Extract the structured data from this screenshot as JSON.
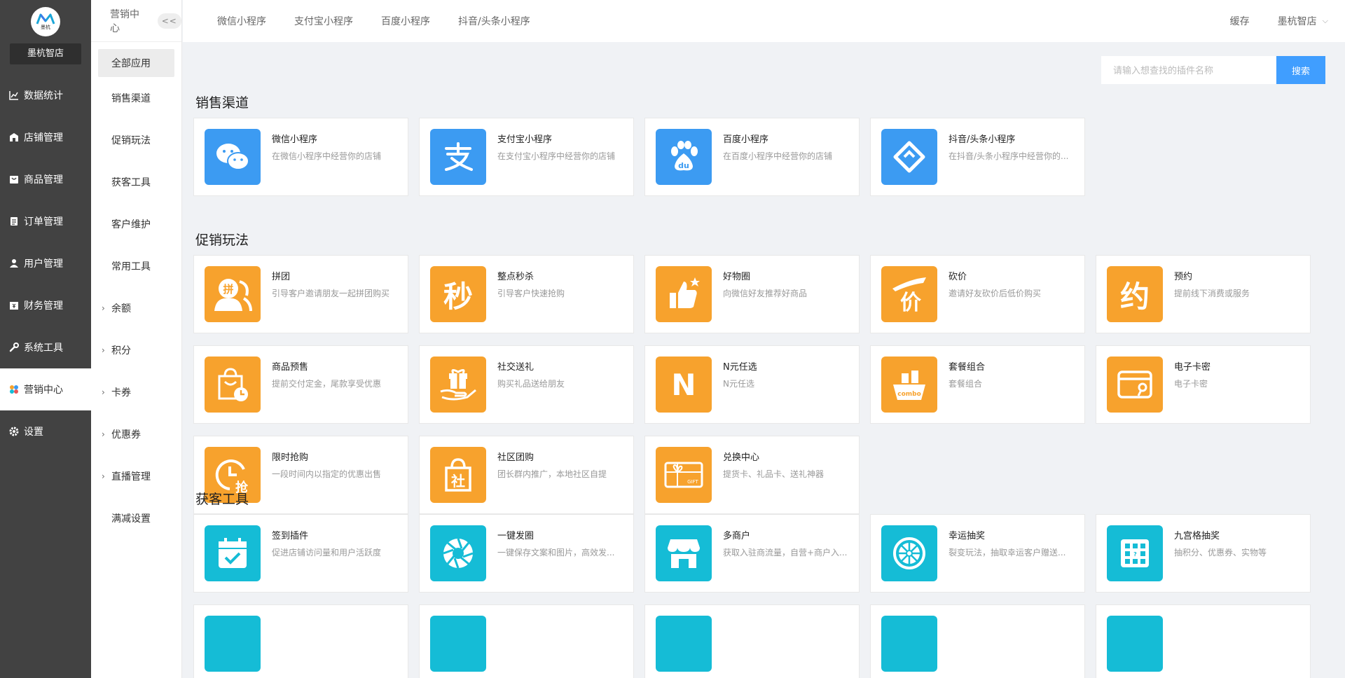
{
  "sidebar": {
    "logo_text": "墨杭",
    "shop_name": "墨杭智店",
    "items": [
      {
        "label": "数据统计",
        "icon": "chart-icon"
      },
      {
        "label": "店铺管理",
        "icon": "shop-icon"
      },
      {
        "label": "商品管理",
        "icon": "goods-icon"
      },
      {
        "label": "订单管理",
        "icon": "order-icon"
      },
      {
        "label": "用户管理",
        "icon": "user-icon"
      },
      {
        "label": "财务管理",
        "icon": "finance-icon"
      },
      {
        "label": "系统工具",
        "icon": "wrench-icon"
      },
      {
        "label": "营销中心",
        "icon": "marketing-icon"
      },
      {
        "label": "设置",
        "icon": "gear-icon"
      }
    ]
  },
  "subnav": {
    "title": "营销中心",
    "collapse_label": "<<",
    "items": [
      "全部应用",
      "销售渠道",
      "促销玩法",
      "获客工具",
      "客户维护",
      "常用工具"
    ],
    "expandable": [
      "余额",
      "积分",
      "卡券",
      "优惠券",
      "直播管理"
    ],
    "last": "满减设置"
  },
  "topbar": {
    "tabs": [
      "微信小程序",
      "支付宝小程序",
      "百度小程序",
      "抖音/头条小程序"
    ],
    "cache": "缓存",
    "user": "墨杭智店"
  },
  "search": {
    "placeholder": "请输入想查找的插件名称",
    "button": "搜索"
  },
  "sections": {
    "channels": {
      "title": "销售渠道",
      "cards": [
        {
          "name": "微信小程序",
          "desc": "在微信小程序中经营你的店铺",
          "icon": "wechat-icon"
        },
        {
          "name": "支付宝小程序",
          "desc": "在支付宝小程序中经营你的店铺",
          "icon": "alipay-icon"
        },
        {
          "name": "百度小程序",
          "desc": "在百度小程序中经营你的店铺",
          "icon": "baidu-icon"
        },
        {
          "name": "抖音/头条小程序",
          "desc": "在抖音/头条小程序中经营你的...",
          "icon": "douyin-icon"
        }
      ]
    },
    "promo": {
      "title": "促销玩法",
      "cards": [
        {
          "name": "拼团",
          "desc": "引导客户邀请朋友一起拼团购买",
          "icon": "group-buy-icon",
          "glyph": "拼"
        },
        {
          "name": "整点秒杀",
          "desc": "引导客户快速抢购",
          "icon": "flash-sale-icon",
          "glyph": "秒"
        },
        {
          "name": "好物圈",
          "desc": "向微信好友推荐好商品",
          "icon": "thumbs-up-icon"
        },
        {
          "name": "砍价",
          "desc": "邀请好友砍价后低价购买",
          "icon": "bargain-icon",
          "glyph": "价"
        },
        {
          "name": "预约",
          "desc": "提前线下消费或服务",
          "icon": "reservation-icon",
          "glyph": "约"
        },
        {
          "name": "商品预售",
          "desc": "提前交付定金，尾款享受优惠",
          "icon": "presale-bag-icon"
        },
        {
          "name": "社交送礼",
          "desc": "购买礼品送给朋友",
          "icon": "gift-hand-icon"
        },
        {
          "name": "N元任选",
          "desc": "N元任选",
          "icon": "n-choice-icon",
          "glyph": "N"
        },
        {
          "name": "套餐组合",
          "desc": "套餐组合",
          "icon": "combo-icon"
        },
        {
          "name": "电子卡密",
          "desc": "电子卡密",
          "icon": "ecard-icon"
        },
        {
          "name": "限时抢购",
          "desc": "一段时间内以指定的优惠出售",
          "icon": "clock-rush-icon"
        },
        {
          "name": "社区团购",
          "desc": "团长群内推广，本地社区自提",
          "icon": "community-bag-icon"
        },
        {
          "name": "兑换中心",
          "desc": "提货卡、礼品卡、送礼神器",
          "icon": "gift-card-icon"
        }
      ]
    },
    "acquire": {
      "title": "获客工具",
      "cards": [
        {
          "name": "签到插件",
          "desc": "促进店铺访问量和用户活跃度",
          "icon": "calendar-check-icon"
        },
        {
          "name": "一键发圈",
          "desc": "一键保存文案和图片，高效发...",
          "icon": "aperture-icon"
        },
        {
          "name": "多商户",
          "desc": "获取入驻商流量，自营+商户入...",
          "icon": "store-icon"
        },
        {
          "name": "幸运抽奖",
          "desc": "裂变玩法，抽取幸运客户赠送...",
          "icon": "wheel-icon"
        },
        {
          "name": "九宫格抽奖",
          "desc": "抽积分、优惠券、实物等",
          "icon": "grid-lottery-icon"
        }
      ]
    }
  },
  "colors": {
    "sidebar_bg": "#424242",
    "accent_blue": "#409eff",
    "channel_blue": "#3c9bf2",
    "promo_orange": "#f7a22d",
    "acquire_teal": "#15bcd6"
  }
}
